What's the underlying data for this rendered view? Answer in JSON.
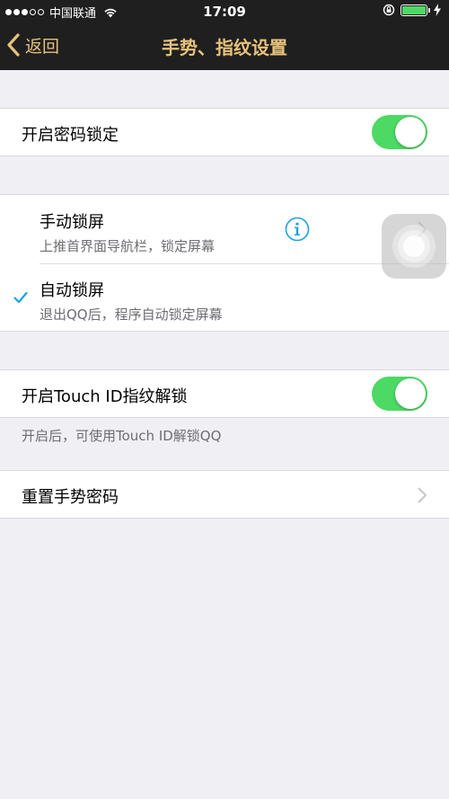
{
  "status_bar": {
    "carrier": "中国联通",
    "time": "17:09",
    "signal_bars_full": 3,
    "signal_bars_total": 5,
    "battery_level": 1.0
  },
  "nav": {
    "back_label": "返回",
    "title": "手势、指纹设置"
  },
  "password_lock": {
    "label": "开启密码锁定",
    "enabled": true
  },
  "lock_modes": [
    {
      "title": "手动锁屏",
      "subtitle": "上推首界面导航栏，锁定屏幕",
      "selected": false
    },
    {
      "title": "自动锁屏",
      "subtitle": "退出QQ后，程序自动锁定屏幕",
      "selected": true
    }
  ],
  "touch_id": {
    "label": "开启Touch ID指纹解锁",
    "enabled": true,
    "footnote": "开启后，可使用Touch ID解锁QQ"
  },
  "reset_gesture": {
    "label": "重置手势密码"
  },
  "colors": {
    "header_bg": "#1f1f1f",
    "accent_gold": "#e7c27a",
    "toggle_on": "#4cd964",
    "check_blue": "#1aa1e6",
    "page_bg": "#efeff4"
  },
  "icons": {
    "back": "chevron-left-icon",
    "info": "info-icon",
    "check": "checkmark-icon",
    "disclosure": "chevron-right-icon"
  }
}
